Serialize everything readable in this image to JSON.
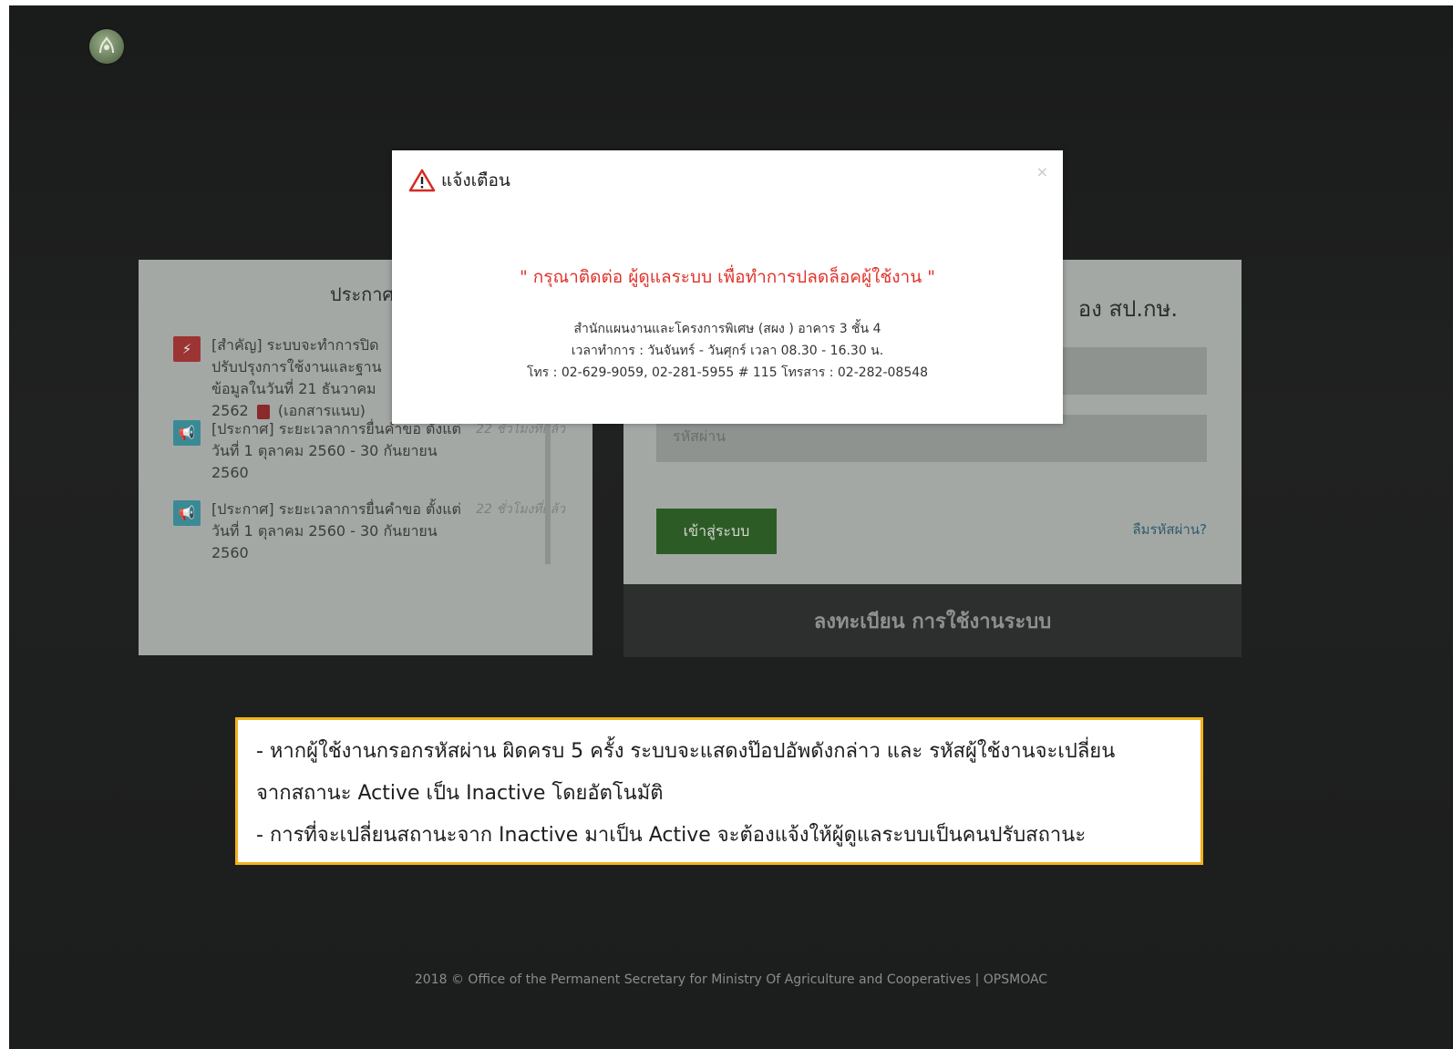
{
  "announcements": {
    "title": "ประกาศ",
    "items": [
      {
        "icon": "lightning-icon",
        "text_before_pdf": "[สำคัญ] ระบบจะทำการปิดปรับปรุงการใช้งานและฐานข้อมูลในวันที่ 21 ธันวาคม 2562",
        "text_after_pdf": "(เอกสารแนบ)",
        "time": ""
      },
      {
        "icon": "megaphone-icon",
        "text": "[ประกาศ] ระยะเวลาการยื่นคำขอ ตั้งแต่ วันที่ 1 ตุลาคม 2560 - 30 กันยายน 2560",
        "time": "22 ชั่วโมงที่แล้ว"
      },
      {
        "icon": "megaphone-icon",
        "text": "[ประกาศ] ระยะเวลาการยื่นคำขอ ตั้งแต่ วันที่ 1 ตุลาคม 2560 - 30 กันยายน 2560",
        "time": "22 ชั่วโมงที่แล้ว"
      }
    ]
  },
  "login": {
    "title": "อง สป.กษ.",
    "username_placeholder": "",
    "password_placeholder": "รหัสผ่าน",
    "submit_label": "เข้าสู่ระบบ",
    "forgot_label": "ลืมรหัสผ่าน?",
    "register_label": "ลงทะเบียน การใช้งานระบบ"
  },
  "modal": {
    "title": "แจ้งเตือน",
    "close": "×",
    "message": "\" กรุณาติดต่อ ผู้ดูแลระบบ เพื่อทำการปลดล็อคผู้ใช้งาน \"",
    "info_line1": "สำนักแผนงานและโครงการพิเศษ (สผง ) อาคาร 3 ชั้น 4",
    "info_line2": "เวลาทำการ : วันจันทร์ - วันศุกร์ เวลา 08.30 - 16.30 น.",
    "info_line3": "โทร : 02-629-9059, 02-281-5955 # 115 โทรสาร : 02-282-08548"
  },
  "note": {
    "line1": "- หากผู้ใช้งานกรอกรหัสผ่าน ผิดครบ 5 ครั้ง ระบบจะแสดงป๊อปอัพดังกล่าว และ รหัสผู้ใช้งานจะเปลี่ยน",
    "line2": "จากสถานะ Active เป็น Inactive โดยอัตโนมัติ",
    "line3": "- การที่จะเปลี่ยนสถานะจาก Inactive มาเป็น Active จะต้องแจ้งให้ผู้ดูแลระบบเป็นคนปรับสถานะ"
  },
  "footer": {
    "text": "2018 © Office of the Permanent Secretary for Ministry Of Agriculture and Cooperatives  |  OPSMOAC"
  },
  "colors": {
    "alert_red": "#e0332b",
    "note_border": "#f3b21a",
    "login_button": "#2d5b26"
  }
}
